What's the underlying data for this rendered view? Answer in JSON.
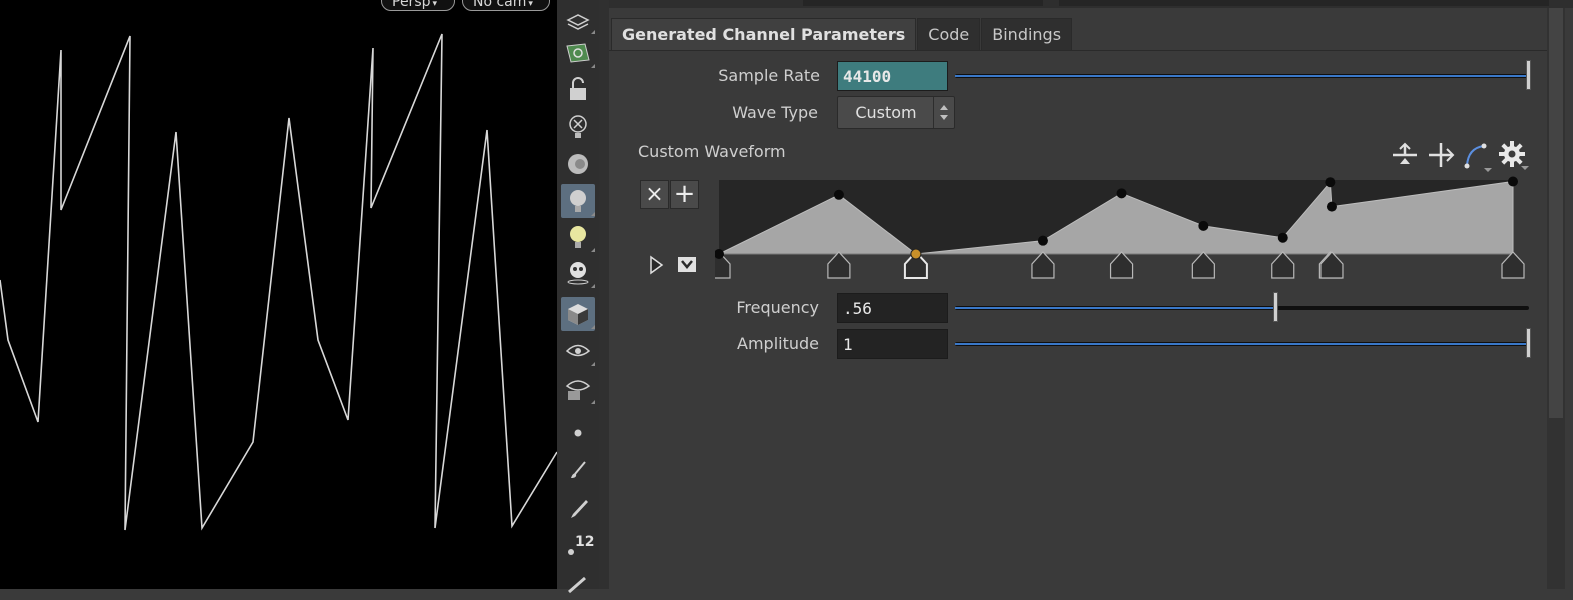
{
  "viewport": {
    "persp_label": "Persp",
    "cam_label": "No cam"
  },
  "toolbar": {
    "icons": [
      "select-geometry-icon",
      "snapping-icon",
      "lock-icon",
      "close-light-icon",
      "ghost-icon",
      "light-icon",
      "light-bulb-icon",
      "light-skull-icon",
      "display-shaded-icon",
      "eye-icon",
      "eye-camera-icon",
      "point-icon",
      "brush-icon",
      "pen-icon",
      "vertex-count-icon",
      "edit-icon"
    ],
    "count_label": "12"
  },
  "tabs": [
    {
      "label": "Generated Channel Parameters",
      "active": true
    },
    {
      "label": "Code",
      "active": false
    },
    {
      "label": "Bindings",
      "active": false
    }
  ],
  "params": {
    "sample_rate_label": "Sample Rate",
    "sample_rate_value": "44100",
    "sample_rate_fraction": 1.0,
    "wave_type_label": "Wave Type",
    "wave_type_value": "Custom",
    "custom_waveform_label": "Custom Waveform",
    "frequency_label": "Frequency",
    "frequency_value": ".56",
    "frequency_fraction": 0.56,
    "amplitude_label": "Amplitude",
    "amplitude_value": "1",
    "amplitude_fraction": 1.0
  },
  "ramp": {
    "delete_label": "×",
    "add_label": "+",
    "keys": [
      {
        "pos": 0.0,
        "value": 0.0,
        "selected": false
      },
      {
        "pos": 0.151,
        "value": 0.8,
        "selected": false
      },
      {
        "pos": 0.248,
        "value": 0.0,
        "selected": true
      },
      {
        "pos": 0.408,
        "value": 0.18,
        "selected": false
      },
      {
        "pos": 0.507,
        "value": 0.82,
        "selected": false
      },
      {
        "pos": 0.61,
        "value": 0.38,
        "selected": false
      },
      {
        "pos": 0.71,
        "value": 0.22,
        "selected": false
      },
      {
        "pos": 0.77,
        "value": 0.97,
        "selected": false
      },
      {
        "pos": 0.772,
        "value": 0.64,
        "selected": false
      },
      {
        "pos": 1.0,
        "value": 0.98,
        "selected": false
      }
    ]
  },
  "colors": {
    "accent": "#3a78c8",
    "selected_field": "#3e7c7e",
    "selected_key": "#c8902a",
    "ramp_fill": "#a6a6a6",
    "ramp_bg": "#262626"
  }
}
